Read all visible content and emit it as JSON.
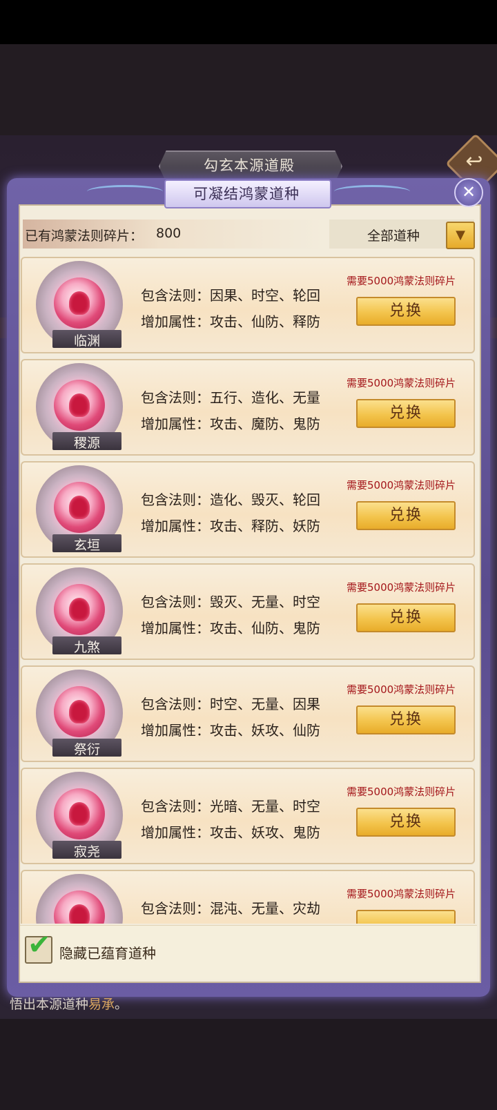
{
  "background": {
    "bottom_text_prefix": "悟出本源道种",
    "bottom_text_accent": "易承",
    "bottom_text_suffix": "。"
  },
  "header": {
    "title": "勾玄本源道殿",
    "subtitle": "可凝结鸿蒙道种"
  },
  "toolbar": {
    "fragments_label": "已有鸿蒙法则碎片：",
    "fragments_value": "800",
    "filter_selected": "全部道种"
  },
  "cards": [
    {
      "name": "临渊",
      "laws": "包含法则：因果、时空、轮回",
      "attrs": "增加属性：攻击、仙防、释防",
      "need": "需要5000鸿蒙法则碎片",
      "button": "兑换"
    },
    {
      "name": "稷源",
      "laws": "包含法则：五行、造化、无量",
      "attrs": "增加属性：攻击、魔防、鬼防",
      "need": "需要5000鸿蒙法则碎片",
      "button": "兑换"
    },
    {
      "name": "玄垣",
      "laws": "包含法则：造化、毁灭、轮回",
      "attrs": "增加属性：攻击、释防、妖防",
      "need": "需要5000鸿蒙法则碎片",
      "button": "兑换"
    },
    {
      "name": "九煞",
      "laws": "包含法则：毁灭、无量、时空",
      "attrs": "增加属性：攻击、仙防、鬼防",
      "need": "需要5000鸿蒙法则碎片",
      "button": "兑换"
    },
    {
      "name": "祭衍",
      "laws": "包含法则：时空、无量、因果",
      "attrs": "增加属性：攻击、妖攻、仙防",
      "need": "需要5000鸿蒙法则碎片",
      "button": "兑换"
    },
    {
      "name": "寂尧",
      "laws": "包含法则：光暗、无量、时空",
      "attrs": "增加属性：攻击、妖攻、鬼防",
      "need": "需要5000鸿蒙法则碎片",
      "button": "兑换"
    },
    {
      "name": "",
      "laws": "包含法则：混沌、无量、灾劫",
      "attrs": "",
      "need": "需要5000鸿蒙法则碎片",
      "button": ""
    }
  ],
  "footer": {
    "hide_label": "隐藏已蕴育道种",
    "hide_checked": true
  },
  "icons": {
    "back": "back-arrow-icon",
    "close": "close-icon",
    "dropdown": "chevron-down-icon",
    "check": "check-icon"
  }
}
